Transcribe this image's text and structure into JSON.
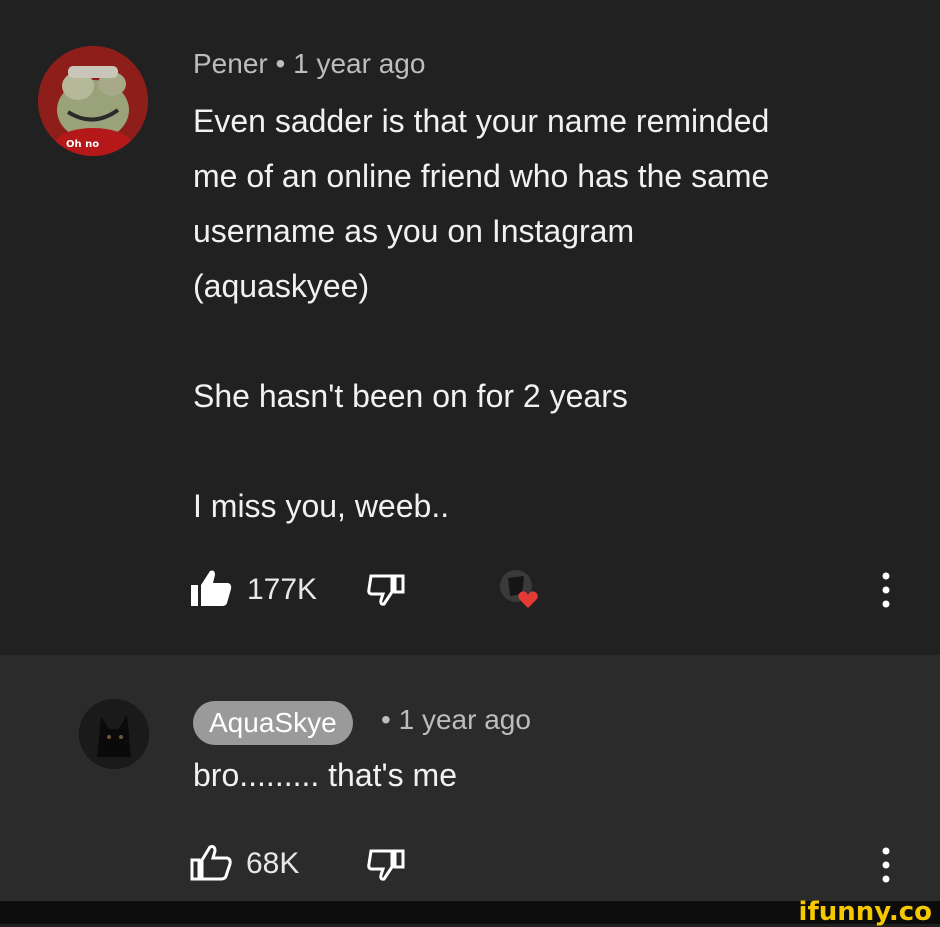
{
  "comment": {
    "author": "Pener",
    "separator": "•",
    "time": "1 year ago",
    "avatar_badge": "Oh no",
    "lines": [
      "Even sadder is that your name reminded",
      "me of an online friend who has the same",
      "username as you on Instagram",
      "(aquaskyee)",
      "",
      "She hasn't been on for 2 years",
      "",
      "I miss you, weeb.."
    ],
    "like_count": "177K",
    "liked": true,
    "creator_hearted": true,
    "icons": {
      "like": "thumbs-up-filled-icon",
      "dislike": "thumbs-down-icon",
      "heart": "heart-icon",
      "more": "more-vertical-icon"
    }
  },
  "reply": {
    "author": "AquaSkye",
    "separator": "•",
    "time": "1 year ago",
    "text": "bro......... that's me",
    "like_count": "68K",
    "icons": {
      "like": "thumbs-up-outline-icon",
      "dislike": "thumbs-down-icon",
      "more": "more-vertical-icon"
    }
  },
  "watermark": "ifunny.co",
  "colors": {
    "background": "#212121",
    "reply_background": "#2b2b2b",
    "heart": "#e53935",
    "watermark": "#f5c800",
    "author_chip": "#9a9a9a"
  }
}
